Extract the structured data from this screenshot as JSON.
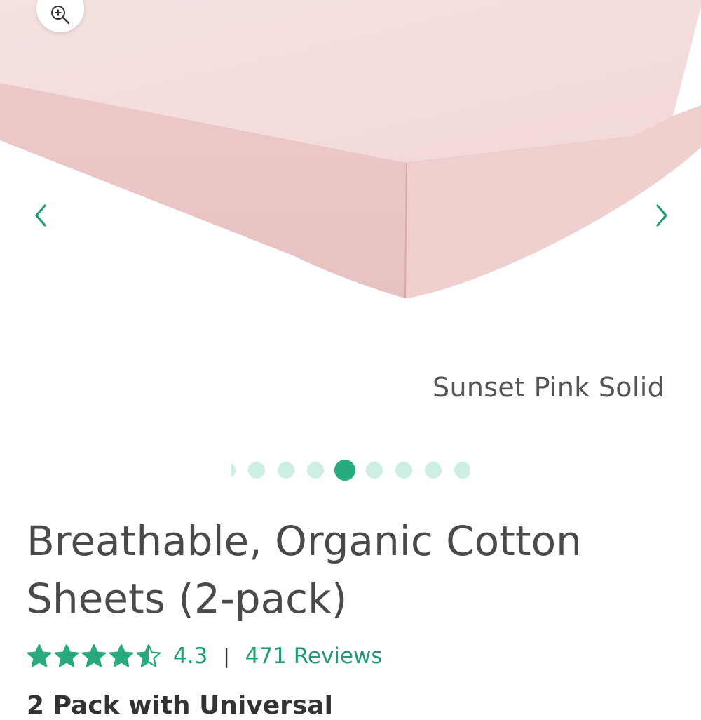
{
  "product": {
    "variant_name": "Sunset Pink Solid",
    "title": "Breathable, Organic Cotton Sheets (2-pack)",
    "rating": {
      "value": "4.3",
      "stars_filled": 4.3,
      "stars_total": 5,
      "separator": "|",
      "reviews_label": "471 Reviews"
    },
    "subtitle_partial": "2 Pack with Universal"
  },
  "gallery": {
    "dots_total": 9,
    "active_index": 4
  },
  "colors": {
    "accent": "#29a97e",
    "accent_text": "#1f9a73",
    "dot_inactive": "#cfeee3",
    "sheet_pink": "#f3dcdc"
  },
  "icons": {
    "zoom": "zoom-in-icon",
    "prev": "chevron-left-icon",
    "next": "chevron-right-icon",
    "star": "star-icon"
  }
}
